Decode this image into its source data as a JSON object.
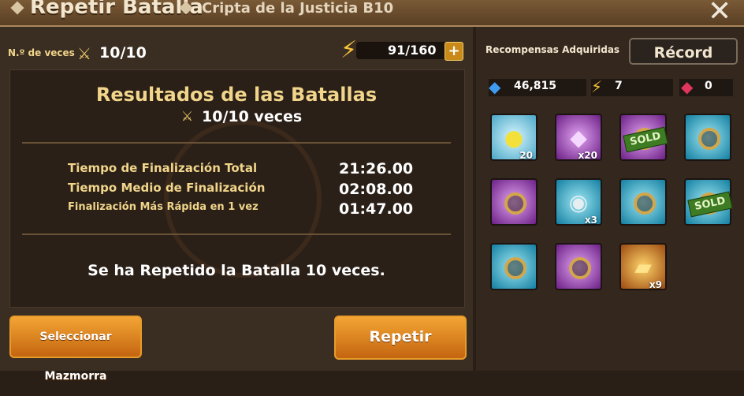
{
  "header": {
    "title": "Repetir Batalla",
    "subtitle": "Cripta de la Justicia B10",
    "close_label": "✕"
  },
  "left": {
    "count_label": "N.º de veces",
    "count_value": "10/10",
    "energy": "91/160",
    "plus_label": "+",
    "results_title": "Resultados de las Batallas",
    "results_count": "10/10 veces",
    "rows": [
      {
        "label": "Tiempo de Finalización Total",
        "value": "21:26.00"
      },
      {
        "label": "Tiempo Medio de Finalización",
        "value": "02:08.00"
      },
      {
        "label": "Finalización Más Rápida en 1 vez",
        "value": "01:47.00"
      }
    ],
    "repeated_text": "Se ha Repetido la Batalla 10 veces.",
    "select_button": "Seleccionar Mazmorra",
    "repeat_button": "Repetir"
  },
  "right": {
    "rewards_title": "Recompensas Adquiridas",
    "record_button": "Récord",
    "resources": [
      {
        "icon": "crystal-icon",
        "value": "46,815"
      },
      {
        "icon": "energy-icon",
        "value": "7"
      },
      {
        "icon": "ruby-icon",
        "value": "0"
      }
    ],
    "rewards": [
      {
        "name": "monster-reward",
        "qty": "20"
      },
      {
        "name": "mystic-scroll-reward",
        "qty": "x20"
      },
      {
        "name": "sold-rune-reward",
        "sold_label": "SOLD"
      },
      {
        "name": "rune-blue-reward"
      },
      {
        "name": "rune-purple-reward"
      },
      {
        "name": "summoning-stone-reward",
        "qty": "x3"
      },
      {
        "name": "rune-blue-reward"
      },
      {
        "name": "sold-rune-reward",
        "sold_label": "SOLD"
      },
      {
        "name": "rune-blue-reward"
      },
      {
        "name": "rune-purple-reward"
      },
      {
        "name": "craft-material-reward",
        "qty": "x9"
      }
    ]
  },
  "colors": {
    "accent_orange": "#e89b2a",
    "gold_text": "#f0d58a"
  }
}
